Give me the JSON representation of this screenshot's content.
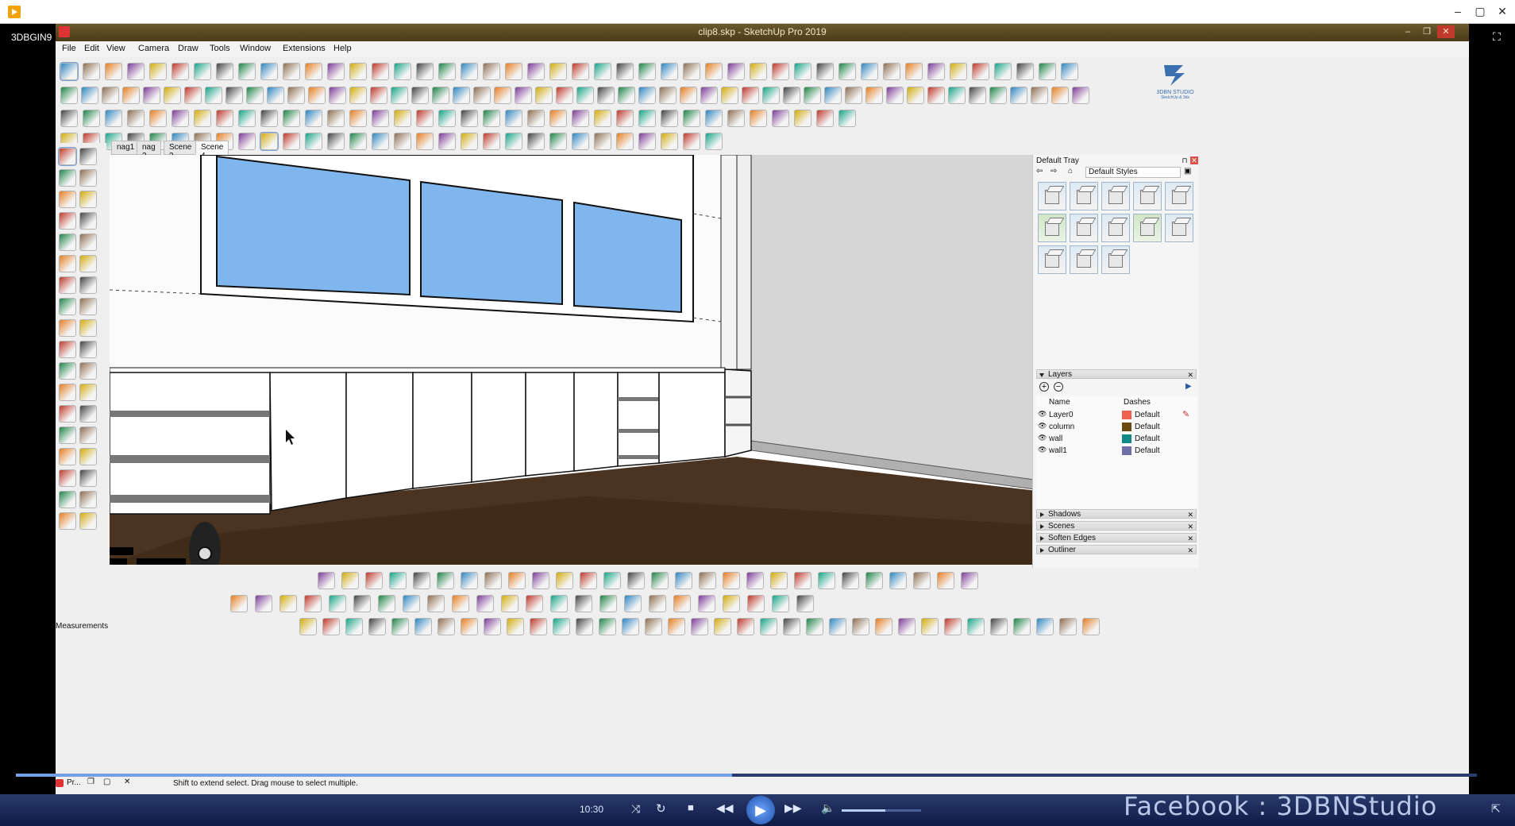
{
  "player": {
    "label_left": "3DBGIN9",
    "time": "10:30",
    "watermark": "Facebook : 3DBNStudio",
    "seek_fraction": 0.49,
    "volume_fraction": 0.55
  },
  "window": {
    "title": "clip8.skp - SketchUp Pro 2019"
  },
  "menu": [
    "File",
    "Edit",
    "View",
    "Camera",
    "Draw",
    "Tools",
    "Window",
    "Extensions",
    "Help"
  ],
  "scenes": [
    "nag1",
    "nag 2",
    "Scene 3",
    "Scene 4"
  ],
  "active_scene": "Scene 4",
  "logo": {
    "name": "3DBN STUDIO",
    "sub": "SketchUp & 3ds"
  },
  "tray": {
    "title": "Default Tray",
    "styles_select": "Default Styles",
    "layers_title": "Layers",
    "layers_columns": {
      "name": "Name",
      "dashes": "Dashes"
    },
    "layers": [
      {
        "name": "Layer0",
        "dashes": "Default",
        "color": "#f0604f"
      },
      {
        "name": "column",
        "dashes": "Default",
        "color": "#6b4a12"
      },
      {
        "name": "wall",
        "dashes": "Default",
        "color": "#0f8a88"
      },
      {
        "name": "wall1",
        "dashes": "Default",
        "color": "#7070a8"
      }
    ],
    "collapsed_panels": [
      "Shadows",
      "Scenes",
      "Soften Edges",
      "Outliner"
    ]
  },
  "status": {
    "measurements_label": "Measurements",
    "hint": "Shift to extend select. Drag mouse to select multiple.",
    "taskbar_item": "Pr..."
  },
  "colors": {
    "sky": "#7fb6ee",
    "floor": "#4a3320",
    "player_bg": "#1a2a5a"
  }
}
